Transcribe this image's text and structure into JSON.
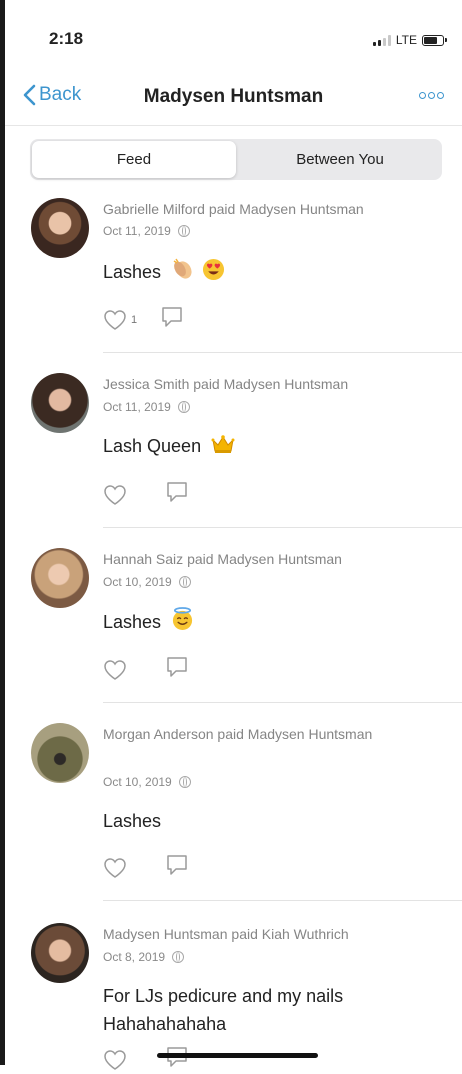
{
  "status": {
    "time": "2:18",
    "network": "LTE"
  },
  "nav": {
    "back_label": "Back",
    "title": "Madysen Huntsman"
  },
  "tabs": [
    {
      "label": "Feed"
    },
    {
      "label": "Between You"
    }
  ],
  "feed": [
    {
      "payer": "Gabrielle Milford",
      "paid": "paid",
      "payee": "Madysen Huntsman",
      "date": "Oct 11, 2019",
      "note": "Lashes",
      "emojis": [
        "clap-icon",
        "heart-eyes-icon"
      ],
      "likes": "1"
    },
    {
      "payer": "Jessica Smith",
      "paid": "paid",
      "payee": "Madysen Huntsman",
      "date": "Oct 11, 2019",
      "note": "Lash Queen",
      "emojis": [
        "crown-icon"
      ],
      "likes": ""
    },
    {
      "payer": "Hannah Saiz",
      "paid": "paid",
      "payee": "Madysen Huntsman",
      "date": "Oct 10, 2019",
      "note": "Lashes",
      "emojis": [
        "halo-face-icon"
      ],
      "likes": ""
    },
    {
      "payer": "Morgan Anderson",
      "paid": "paid",
      "payee": "Madysen Huntsman",
      "date": "Oct 10, 2019",
      "note": "Lashes",
      "emojis": [],
      "likes": ""
    },
    {
      "payer": "Madysen Huntsman",
      "paid": "paid",
      "payee": "Kiah Wuthrich",
      "date": "Oct 8, 2019",
      "note": "For LJs pedicure and my nails Hahahahahaha",
      "emojis": [],
      "likes": ""
    }
  ],
  "colors": {
    "accent": "#3d95ce",
    "meta_text": "#858585"
  }
}
